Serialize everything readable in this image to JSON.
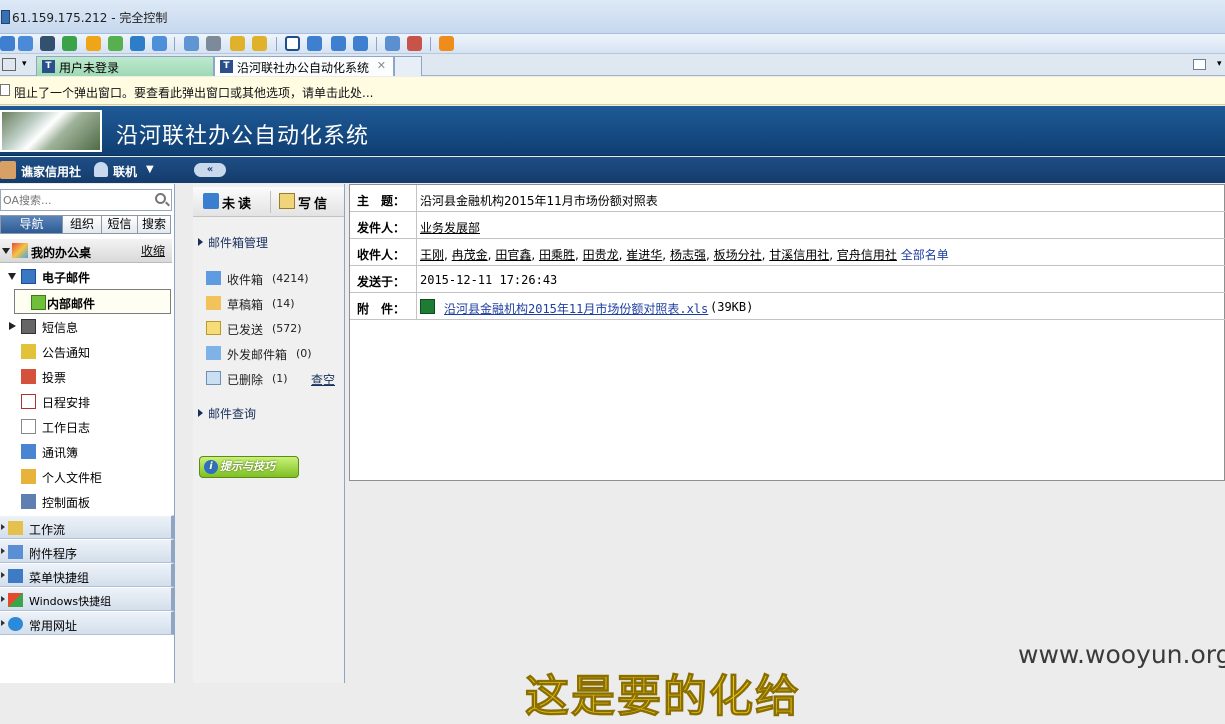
{
  "window": {
    "title": "61.159.175.212 - 完全控制"
  },
  "tabs": [
    {
      "label": "用户未登录",
      "active": false
    },
    {
      "label": "沿河联社办公自动化系统",
      "active": true,
      "close": "✕"
    }
  ],
  "infobar": {
    "text": "阻止了一个弹出窗口。要查看此弹出窗口或其他选项，请单击此处..."
  },
  "banner": {
    "title": "沿河联社办公自动化系统"
  },
  "userbar": {
    "user": "谯家信用社",
    "status": "联机",
    "caret": "▼",
    "collapse": "«"
  },
  "search": {
    "placeholder": "OA搜索..."
  },
  "nav_tabs": [
    "导航",
    "组织",
    "短信",
    "搜索"
  ],
  "tree": {
    "desk_label": "我的办公桌",
    "desk_action": "收缩",
    "email": "电子邮件",
    "internal_mail": "内部邮件",
    "items": [
      "短信息",
      "公告通知",
      "投票",
      "日程安排",
      "工作日志",
      "通讯簿",
      "个人文件柜",
      "控制面板"
    ]
  },
  "groups": [
    "工作流",
    "附件程序",
    "菜单快捷组",
    "Windows快捷组",
    "常用网址"
  ],
  "mail": {
    "unread": "未读",
    "compose": "写信",
    "manage": "邮件箱管理",
    "folders": [
      {
        "name": "收件箱",
        "count": "(4214)"
      },
      {
        "name": "草稿箱",
        "count": "(14)"
      },
      {
        "name": "已发送",
        "count": "(572)"
      },
      {
        "name": "外发邮件箱",
        "count": "(0)"
      },
      {
        "name": "已删除",
        "count": "(1)"
      }
    ],
    "empty": "查空",
    "query": "邮件查询",
    "tips": "提示与技巧"
  },
  "message": {
    "subject_label": "主　题：",
    "subject": "沿河县金融机构2015年11月市场份额对照表",
    "from_label": "发件人：",
    "from": "业务发展部",
    "to_label": "收件人：",
    "recipients": [
      "王刚",
      "冉茂金",
      "田官鑫",
      "田乘胜",
      "田贵龙",
      "崔进华",
      "杨志强",
      "板场分社",
      "甘溪信用社",
      "官舟信用社"
    ],
    "all_list": "全部名单",
    "time_label": "发送于：",
    "time": "2015-12-11 17:26:43",
    "attach_label": "附　件：",
    "attachment": "沿河县金融机构2015年11月市场份额对照表.xls",
    "attachment_size": "(39KB)"
  },
  "overlay": {
    "watermark": "www.wooyun.org",
    "partial_text": "这是要的化给"
  },
  "colors": {
    "banner": "#1f5a96",
    "userbar": "#1e4e86",
    "link": "#1d3fa1",
    "info": "#fffce1"
  }
}
